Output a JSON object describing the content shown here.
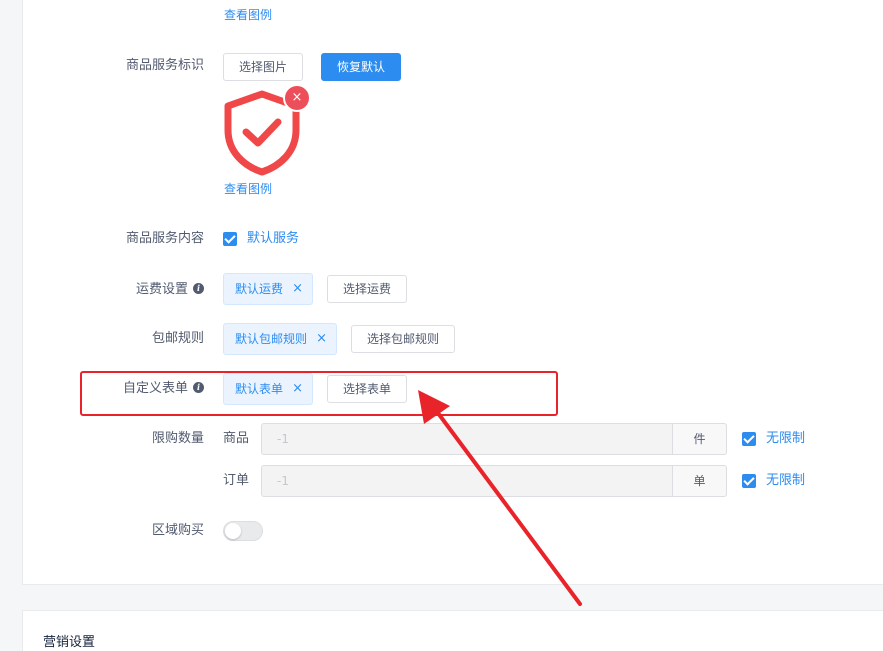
{
  "top_link": "查看图例",
  "service_icon": {
    "label": "商品服务标识",
    "select_button": "选择图片",
    "reset_button": "恢复默认",
    "example_link": "查看图例"
  },
  "service_content": {
    "label": "商品服务内容",
    "checkbox_label": "默认服务"
  },
  "shipping": {
    "label": "运费设置",
    "tag": "默认运费",
    "button": "选择运费"
  },
  "free_shipping": {
    "label": "包邮规则",
    "tag": "默认包邮规则",
    "button": "选择包邮规则"
  },
  "custom_form": {
    "label": "自定义表单",
    "tag": "默认表单",
    "button": "选择表单"
  },
  "purchase_limit": {
    "label": "限购数量",
    "rows": [
      {
        "label": "商品",
        "placeholder": "-1",
        "unit": "件",
        "checkbox_label": "无限制"
      },
      {
        "label": "订单",
        "placeholder": "-1",
        "unit": "单",
        "checkbox_label": "无限制"
      }
    ]
  },
  "region_purchase": {
    "label": "区域购买"
  },
  "marketing": {
    "title": "营销设置"
  },
  "colors": {
    "primary": "#2d8cf0",
    "highlight_red": "#e8242a",
    "shield_red": "#f04848"
  }
}
